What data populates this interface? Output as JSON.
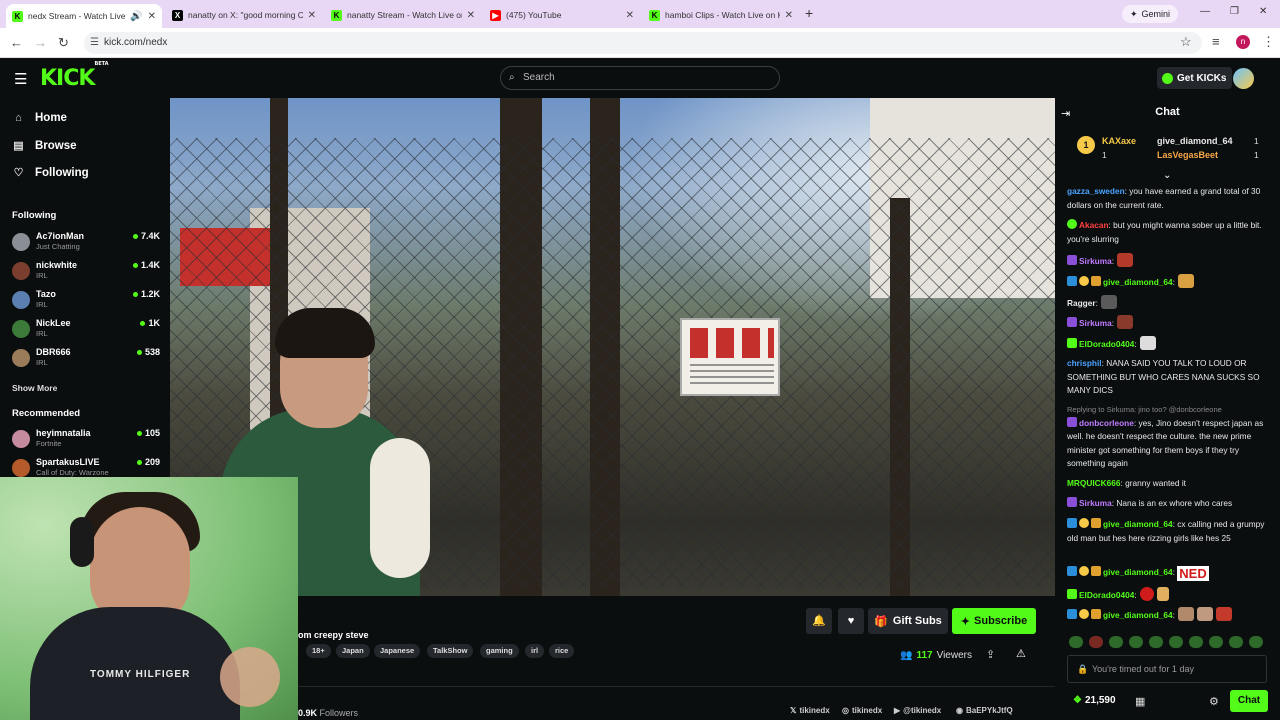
{
  "browser": {
    "tabs": [
      {
        "title": "nedx Stream - Watch Live o",
        "favicon": "kick-icon",
        "color": "#53fc18"
      },
      {
        "title": "nanatty on X: \"good morning C",
        "favicon": "x-icon",
        "color": "#000000"
      },
      {
        "title": "nanatty Stream - Watch Live or",
        "favicon": "kick-icon",
        "color": "#53fc18"
      },
      {
        "title": "(475) YouTube",
        "favicon": "youtube-icon",
        "color": "#ff0000"
      },
      {
        "title": "hamboi Clips - Watch Live on K",
        "favicon": "kick-icon",
        "color": "#53fc18"
      }
    ],
    "gemini_label": "Gemini",
    "url": "kick.com/nedx",
    "profile_letter": "n"
  },
  "header": {
    "logo": "KICK",
    "logo_badge": "BETA",
    "search_placeholder": "Search",
    "get_kicks": "Get KICKs"
  },
  "sidebar": {
    "nav": [
      {
        "label": "Home",
        "icon": "home-icon"
      },
      {
        "label": "Browse",
        "icon": "browse-icon"
      },
      {
        "label": "Following",
        "icon": "heart-icon"
      }
    ],
    "following_title": "Following",
    "following": [
      {
        "name": "Ac7ionMan",
        "category": "Just Chatting",
        "viewers": "7.4K",
        "avatar_color": "#8a8f96"
      },
      {
        "name": "nickwhite",
        "category": "IRL",
        "viewers": "1.4K",
        "avatar_color": "#7a3e2e"
      },
      {
        "name": "Tazo",
        "category": "IRL",
        "viewers": "1.2K",
        "avatar_color": "#5a7fb0"
      },
      {
        "name": "NickLee",
        "category": "IRL",
        "viewers": "1K",
        "avatar_color": "#3c7a3a"
      },
      {
        "name": "DBR666",
        "category": "IRL",
        "viewers": "538",
        "avatar_color": "#9a7b5a"
      }
    ],
    "show_more": "Show More",
    "recommended_title": "Recommended",
    "recommended": [
      {
        "name": "heyimnatalia",
        "category": "Fortnite",
        "viewers": "105",
        "avatar_color": "#c48a9e"
      },
      {
        "name": "SpartakusLIVE",
        "category": "Call of Duty: Warzone",
        "viewers": "209",
        "avatar_color": "#b55a2a"
      }
    ]
  },
  "stream": {
    "title_fragment": "om creepy steve",
    "tags": [
      "18+",
      "Japan",
      "Japanese",
      "TalkShow",
      "gaming",
      "irl",
      "rice"
    ],
    "gift_subs": "Gift Subs",
    "subscribe": "Subscribe",
    "viewers_count": "117",
    "viewers_label": "Viewers",
    "followers_count": "0.9K",
    "followers_label": "Followers",
    "shirt_text": "TOMMY HILFIGER",
    "socials": [
      {
        "label": "tikinedx",
        "icon": "x-icon"
      },
      {
        "label": "tikinedx",
        "icon": "instagram-icon"
      },
      {
        "label": "@tikinedx",
        "icon": "youtube-icon"
      },
      {
        "label": "BaEPYkJtfQ",
        "icon": "discord-icon"
      }
    ]
  },
  "chat": {
    "title": "Chat",
    "pinned_gifters": [
      {
        "name": "KAXaxe",
        "count": "1"
      },
      {
        "name": "give_diamond_64",
        "count": "1"
      },
      {
        "name": "LasVegasBeet",
        "count": "1"
      }
    ],
    "gift_rank": "1",
    "messages": [
      {
        "user": "gazza_sweden",
        "color": "#4aa3ff",
        "text": "you have earned a grand total of 30 dollars on the current rate."
      },
      {
        "user": "Akacan",
        "color": "#ff4040",
        "text": "but you might wanna sober up a little bit. you're slurring"
      },
      {
        "user": "Sirkuma",
        "color": "#c07bff",
        "text": ""
      },
      {
        "user": "give_diamond_64",
        "color": "#53fc18",
        "text": ""
      },
      {
        "user": "Ragger",
        "color": "#e8e8e8",
        "text": ""
      },
      {
        "user": "Sirkuma",
        "color": "#c07bff",
        "text": ""
      },
      {
        "user": "ElDorado0404",
        "color": "#53fc18",
        "text": ""
      },
      {
        "user": "chrisphil",
        "color": "#4aa3ff",
        "text": "NANA SAID YOU TALK TO LOUD OR SOMETHING BUT WHO CARES NANA SUCKS SO MANY DICS"
      },
      {
        "reply": "Replying to Sirkuma: jino too? @donbcorleone",
        "user": "donbcorleone",
        "color": "#c07bff",
        "text": "yes, Jino doesn't respect japan as well. he doesn't respect the culture. the new prime minister got something for them boys if they try something again"
      },
      {
        "user": "MRQUICK666",
        "color": "#53fc18",
        "text": "granny wanted it"
      },
      {
        "user": "Sirkuma",
        "color": "#c07bff",
        "text": "Nana is an ex whore who cares"
      },
      {
        "user": "give_diamond_64",
        "color": "#53fc18",
        "text": "cx calling ned a grumpy old man but hes here rizzing girls like hes 25"
      },
      {
        "user": "give_diamond_64",
        "color": "#53fc18",
        "text": "NED"
      },
      {
        "user": "ElDorado0404",
        "color": "#53fc18",
        "text": ""
      },
      {
        "user": "give_diamond_64",
        "color": "#53fc18",
        "text": ""
      }
    ],
    "timeout_text": "You're timed out for 1 day",
    "kicks_balance": "21,590",
    "send_label": "Chat"
  }
}
